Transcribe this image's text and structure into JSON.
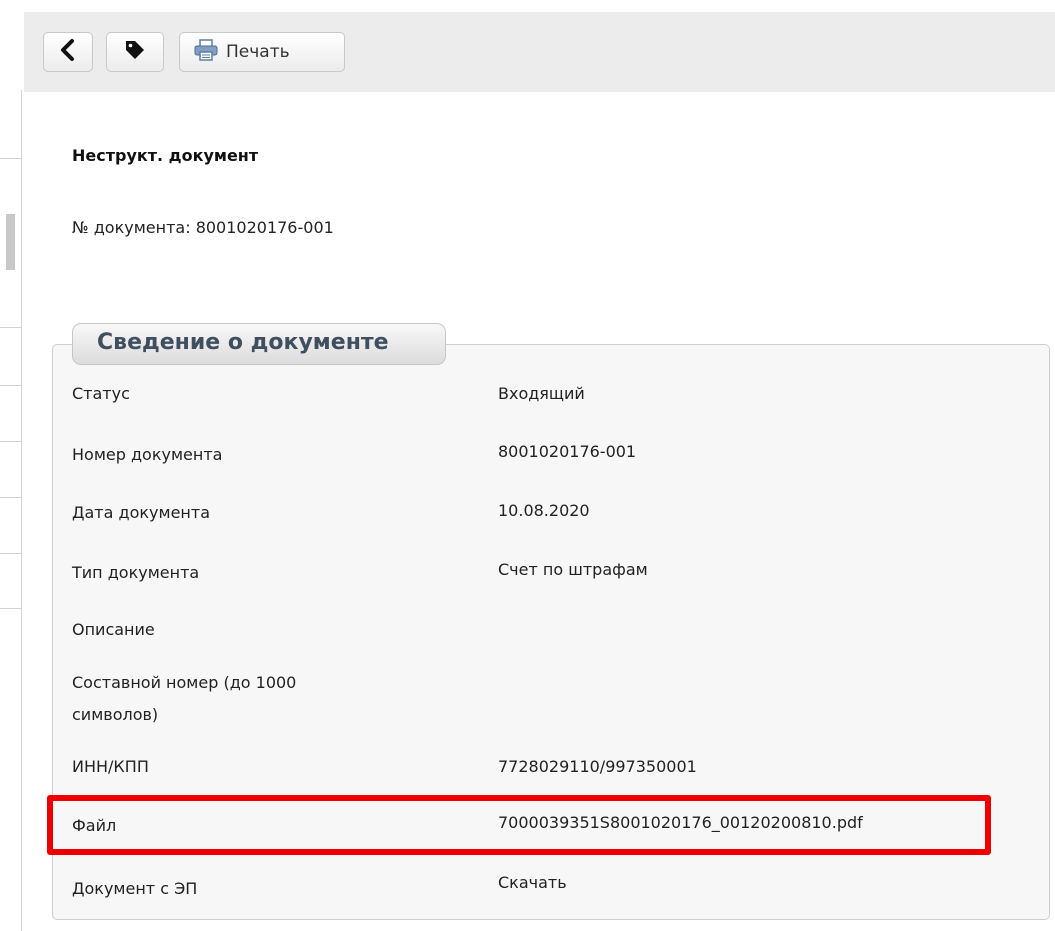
{
  "toolbar": {
    "back_icon": "chevron-left-icon",
    "tag_icon": "tag-icon",
    "print_icon": "printer-icon",
    "print_label": "Печать"
  },
  "document": {
    "title": "Неструкт. документ",
    "number_line": "№ документа: 8001020176-001"
  },
  "info_panel": {
    "legend": "Сведение о документе",
    "rows": [
      {
        "label": "Статус",
        "value": "Входящий"
      },
      {
        "label": "Номер документа",
        "value": "8001020176-001"
      },
      {
        "label": "Дата документа",
        "value": "10.08.2020"
      },
      {
        "label": "Тип документа",
        "value": "Счет по штрафам"
      },
      {
        "label": "Описание",
        "value": ""
      },
      {
        "label": "Составной номер (до 1000",
        "label2": "символов)",
        "value": ""
      },
      {
        "label": "ИНН/КПП",
        "value": "7728029110/997350001"
      },
      {
        "label": "Файл",
        "value": "7000039351S8001020176_00120200810.pdf"
      },
      {
        "label": "Документ с ЭП",
        "value": "Скачать"
      }
    ]
  },
  "colors": {
    "highlight": "#ee0000",
    "legend_text": "#3f4f60"
  }
}
